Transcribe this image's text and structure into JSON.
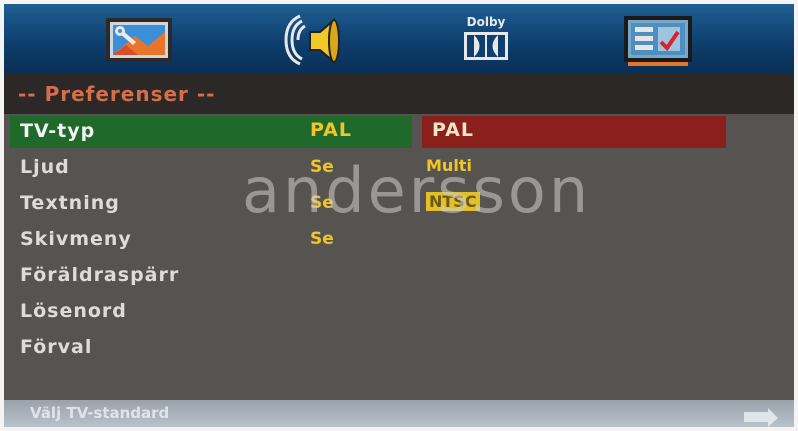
{
  "tabs": [
    {
      "name": "general-setup-icon"
    },
    {
      "name": "audio-speaker-icon"
    },
    {
      "name": "dolby-digital-icon",
      "label": "Dolby"
    },
    {
      "name": "preferences-icon"
    }
  ],
  "menu": {
    "title": "-- Preferenser --",
    "items": [
      {
        "label": "TV-typ",
        "value": "PAL",
        "selected": true
      },
      {
        "label": "Ljud",
        "value": "Se"
      },
      {
        "label": "Textning",
        "value": "Se"
      },
      {
        "label": "Skivmeny",
        "value": "Se"
      },
      {
        "label": "Föräldraspärr",
        "value": ""
      },
      {
        "label": "Lösenord",
        "value": ""
      },
      {
        "label": "Förval",
        "value": ""
      }
    ]
  },
  "options": {
    "items": [
      "PAL",
      "Multi",
      "NTSC"
    ],
    "selected": "PAL"
  },
  "watermark": "andersson",
  "footer": {
    "hint": "Välj TV-standard"
  },
  "colors": {
    "topbar": "#0e3f6e",
    "selected_row": "#1f6a2a",
    "selected_option": "#8b1f1c",
    "title": "#d46f4a",
    "value": "#f0c52a"
  }
}
